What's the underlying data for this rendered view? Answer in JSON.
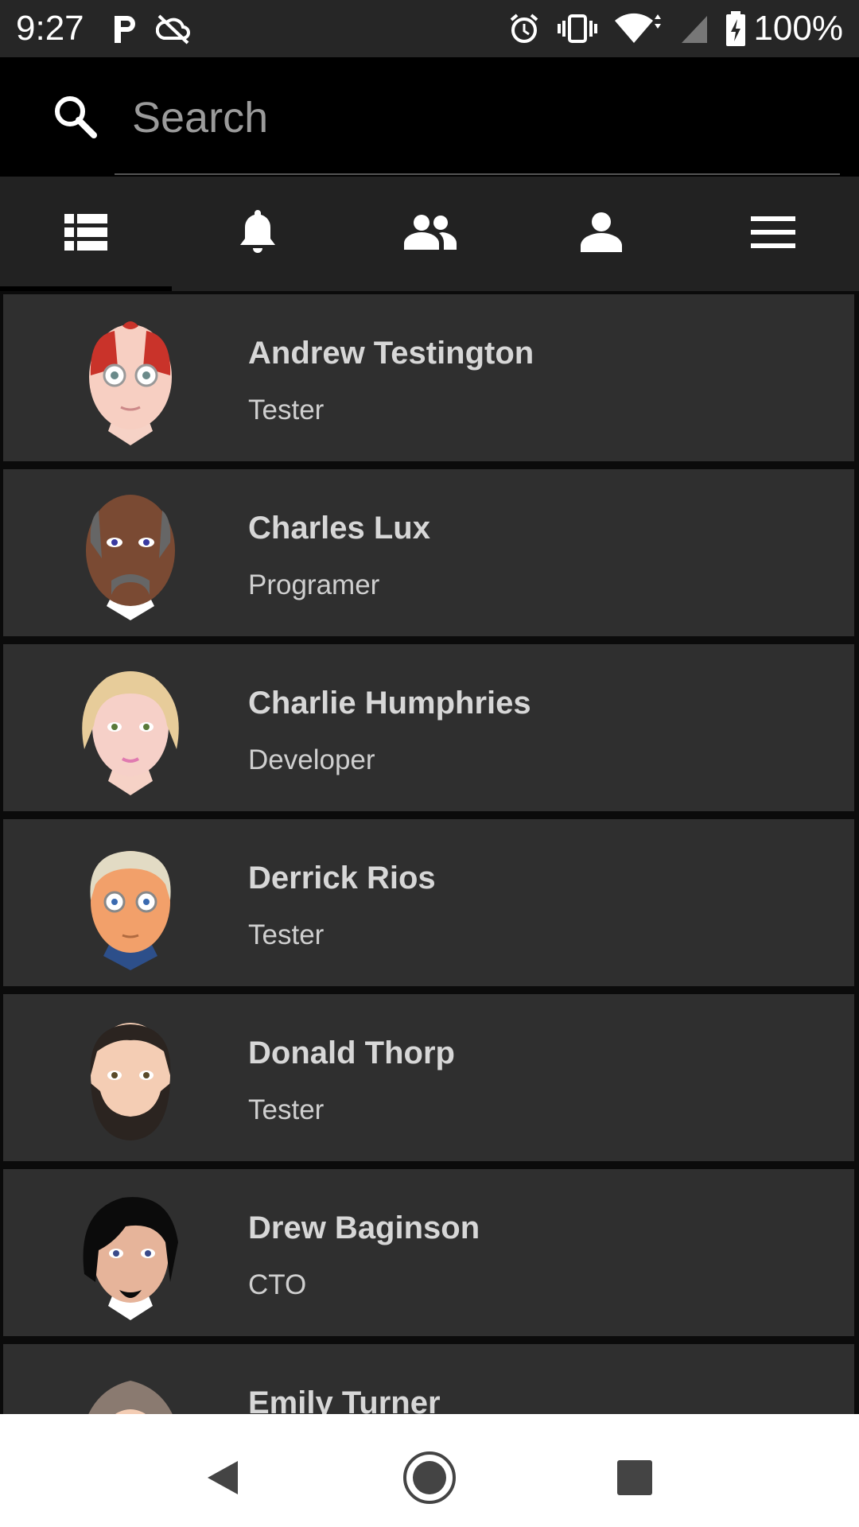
{
  "status_bar": {
    "time": "9:27",
    "battery": "100%",
    "icons": [
      "parking-icon",
      "cloud-off-icon",
      "alarm-icon",
      "vibrate-icon",
      "wifi-icon",
      "signal-icon",
      "battery-charging-icon"
    ]
  },
  "search": {
    "placeholder": "Search"
  },
  "tabs": [
    {
      "icon": "list-icon",
      "selected": true
    },
    {
      "icon": "bell-icon",
      "selected": false
    },
    {
      "icon": "group-icon",
      "selected": false
    },
    {
      "icon": "person-icon",
      "selected": false
    },
    {
      "icon": "menu-icon",
      "selected": false
    }
  ],
  "contacts": [
    {
      "name": "Andrew Testington",
      "role": "Tester"
    },
    {
      "name": "Charles Lux",
      "role": "Programer"
    },
    {
      "name": "Charlie Humphries",
      "role": "Developer"
    },
    {
      "name": "Derrick Rios",
      "role": "Tester"
    },
    {
      "name": "Donald Thorp",
      "role": "Tester"
    },
    {
      "name": "Drew Baginson",
      "role": "CTO"
    },
    {
      "name": "Emily Turner",
      "role": ""
    }
  ],
  "nav": [
    "back-icon",
    "home-icon",
    "recents-icon"
  ],
  "colors": {
    "tab_indicator": "#000000",
    "list_bg": "#2f2f2f",
    "tab_bg": "#222222"
  }
}
